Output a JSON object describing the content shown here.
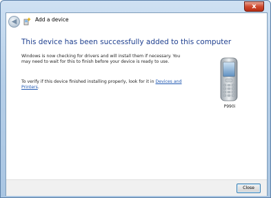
{
  "window": {
    "close_glyph": "x"
  },
  "nav": {
    "back_icon": "back-arrow-icon",
    "wizard_icon": "add-device-icon",
    "title": "Add a device"
  },
  "content": {
    "heading": "This device has been successfully added to this computer",
    "para1": "Windows is now checking for drivers and will install them if necessary. You may need to wait for this to finish before your device is ready to use.",
    "para2_prefix": "To verify if this device finished installing properly, look for it in ",
    "para2_link": "Devices and Printers",
    "para2_suffix": "."
  },
  "device": {
    "icon": "mobile-phone-icon",
    "name": "P990i"
  },
  "footer": {
    "close_label": "Close"
  },
  "colors": {
    "heading": "#1e3f8f",
    "link": "#1c55b0",
    "titlebar_close": "#cf4a2f"
  }
}
